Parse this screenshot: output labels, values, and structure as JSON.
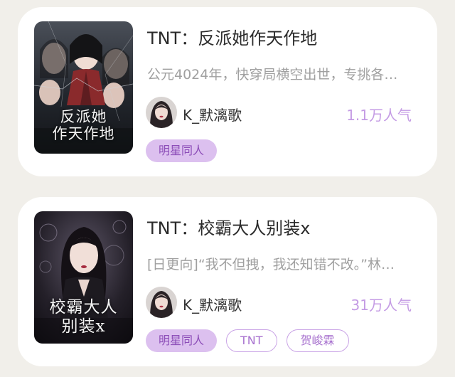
{
  "books": [
    {
      "title": "TNT：反派她作天作地",
      "description": "公元4024年，快穿局横空出世，专挑各…",
      "cover_title_line1": "反派她",
      "cover_title_line2": "作天作地",
      "author": "K_默漓歌",
      "popularity": "1.1万人气",
      "tags": [
        "明星同人"
      ]
    },
    {
      "title": "TNT：校霸大人别装x",
      "description": "[日更向]“我不但拽，我还知错不改。”林…",
      "cover_title_line1": "校霸大人",
      "cover_title_line2": "别装x",
      "author": "K_默漓歌",
      "popularity": "31万人气",
      "tags": [
        "明星同人",
        "TNT",
        "贺峻霖"
      ]
    }
  ],
  "colors": {
    "background": "#f1efea",
    "card": "#ffffff",
    "accent": "#c49be4",
    "tag_filled_bg": "#dcc0ef",
    "tag_text": "#8c4db8"
  }
}
